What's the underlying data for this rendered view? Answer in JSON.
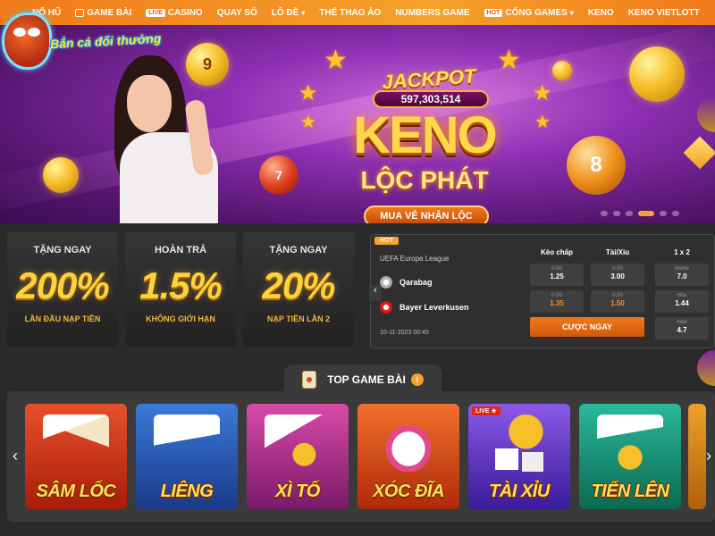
{
  "logo": {
    "text": "Bắn cá đổi thưởng"
  },
  "nav": {
    "items": [
      {
        "label": "NỔ HŨ",
        "badge": "",
        "chevron": false
      },
      {
        "label": "GAME BÀI",
        "badge": "",
        "chevron": false
      },
      {
        "label": "CASINO",
        "badge": "LIVE",
        "chevron": false
      },
      {
        "label": "QUAY SỐ",
        "badge": "",
        "chevron": false
      },
      {
        "label": "LÔ ĐỀ",
        "badge": "",
        "chevron": true
      },
      {
        "label": "THỂ THAO ẢO",
        "badge": "",
        "chevron": false
      },
      {
        "label": "NUMBERS GAME",
        "badge": "",
        "chevron": false
      },
      {
        "label": "CỔNG GAMES",
        "badge": "HOT",
        "chevron": true
      },
      {
        "label": "KENO",
        "badge": "",
        "chevron": false
      },
      {
        "label": "KENO VIETLOTT",
        "badge": "",
        "chevron": false
      }
    ]
  },
  "banner": {
    "jackpot_label": "JACKPOT",
    "jackpot_value": "597,303,514",
    "title": "KENO",
    "subtitle": "LỘC PHÁT",
    "cta": "MUA VÉ NHẬN LỘC",
    "balls": [
      "9",
      "7",
      "8"
    ],
    "slide_count": 6,
    "active_slide": 4
  },
  "promos": [
    {
      "title": "Tặng ngay",
      "value": "200%",
      "subtitle": "Lần đầu nạp tiền"
    },
    {
      "title": "Hoàn trả",
      "value": "1.5%",
      "subtitle": "Không giới hạn"
    },
    {
      "title": "Tặng ngay",
      "value": "20%",
      "subtitle": "Nạp tiền lần 2"
    }
  ],
  "match": {
    "tag": "HOT",
    "league": "UEFA Europa League",
    "home": "Qarabag",
    "away": "Bayer Leverkusen",
    "datetime": "10-11-2023 00:45",
    "columns": [
      "Kèo chấp",
      "Tài/Xỉu",
      "1 x 2"
    ],
    "odds": {
      "handicap": [
        {
          "label": "0.00",
          "value": "1.25",
          "color": "white"
        },
        {
          "label": "0.00",
          "value": "1.35",
          "color": "orange"
        }
      ],
      "total": [
        {
          "label": "0.00",
          "value": "3.00",
          "color": "white"
        },
        {
          "label": "0.00",
          "value": "1.50",
          "color": "orange"
        }
      ],
      "one_x_two": [
        {
          "label": "Home",
          "value": "7.0"
        },
        {
          "label": "Hòa",
          "value": "1.44"
        },
        {
          "label": "Hòa",
          "value": "4.7"
        }
      ]
    },
    "cta": "CƯỢC NGAY"
  },
  "section": {
    "title": "TOP GAME BÀI",
    "info": "i"
  },
  "games": [
    {
      "name": "SÂM LỐC",
      "live": false,
      "bg": "#d93a1e"
    },
    {
      "name": "LIÊNG",
      "live": false,
      "bg": "#2a66c8"
    },
    {
      "name": "XÌ TỐ",
      "live": false,
      "bg": "#c03a9a"
    },
    {
      "name": "XÓC ĐĨA",
      "live": false,
      "bg": "#e2501a"
    },
    {
      "name": "TÀI XỈU",
      "live": true,
      "live_label": "LIVE ★",
      "bg": "#6a3ac8"
    },
    {
      "name": "TIẾN LÊN",
      "live": false,
      "bg": "#1a9a7a"
    }
  ],
  "colors": {
    "accent": "#f5a12a",
    "nav_bg": "#f07a1a",
    "panel_bg": "#2f2f2f",
    "gold": "#ffd23a"
  }
}
